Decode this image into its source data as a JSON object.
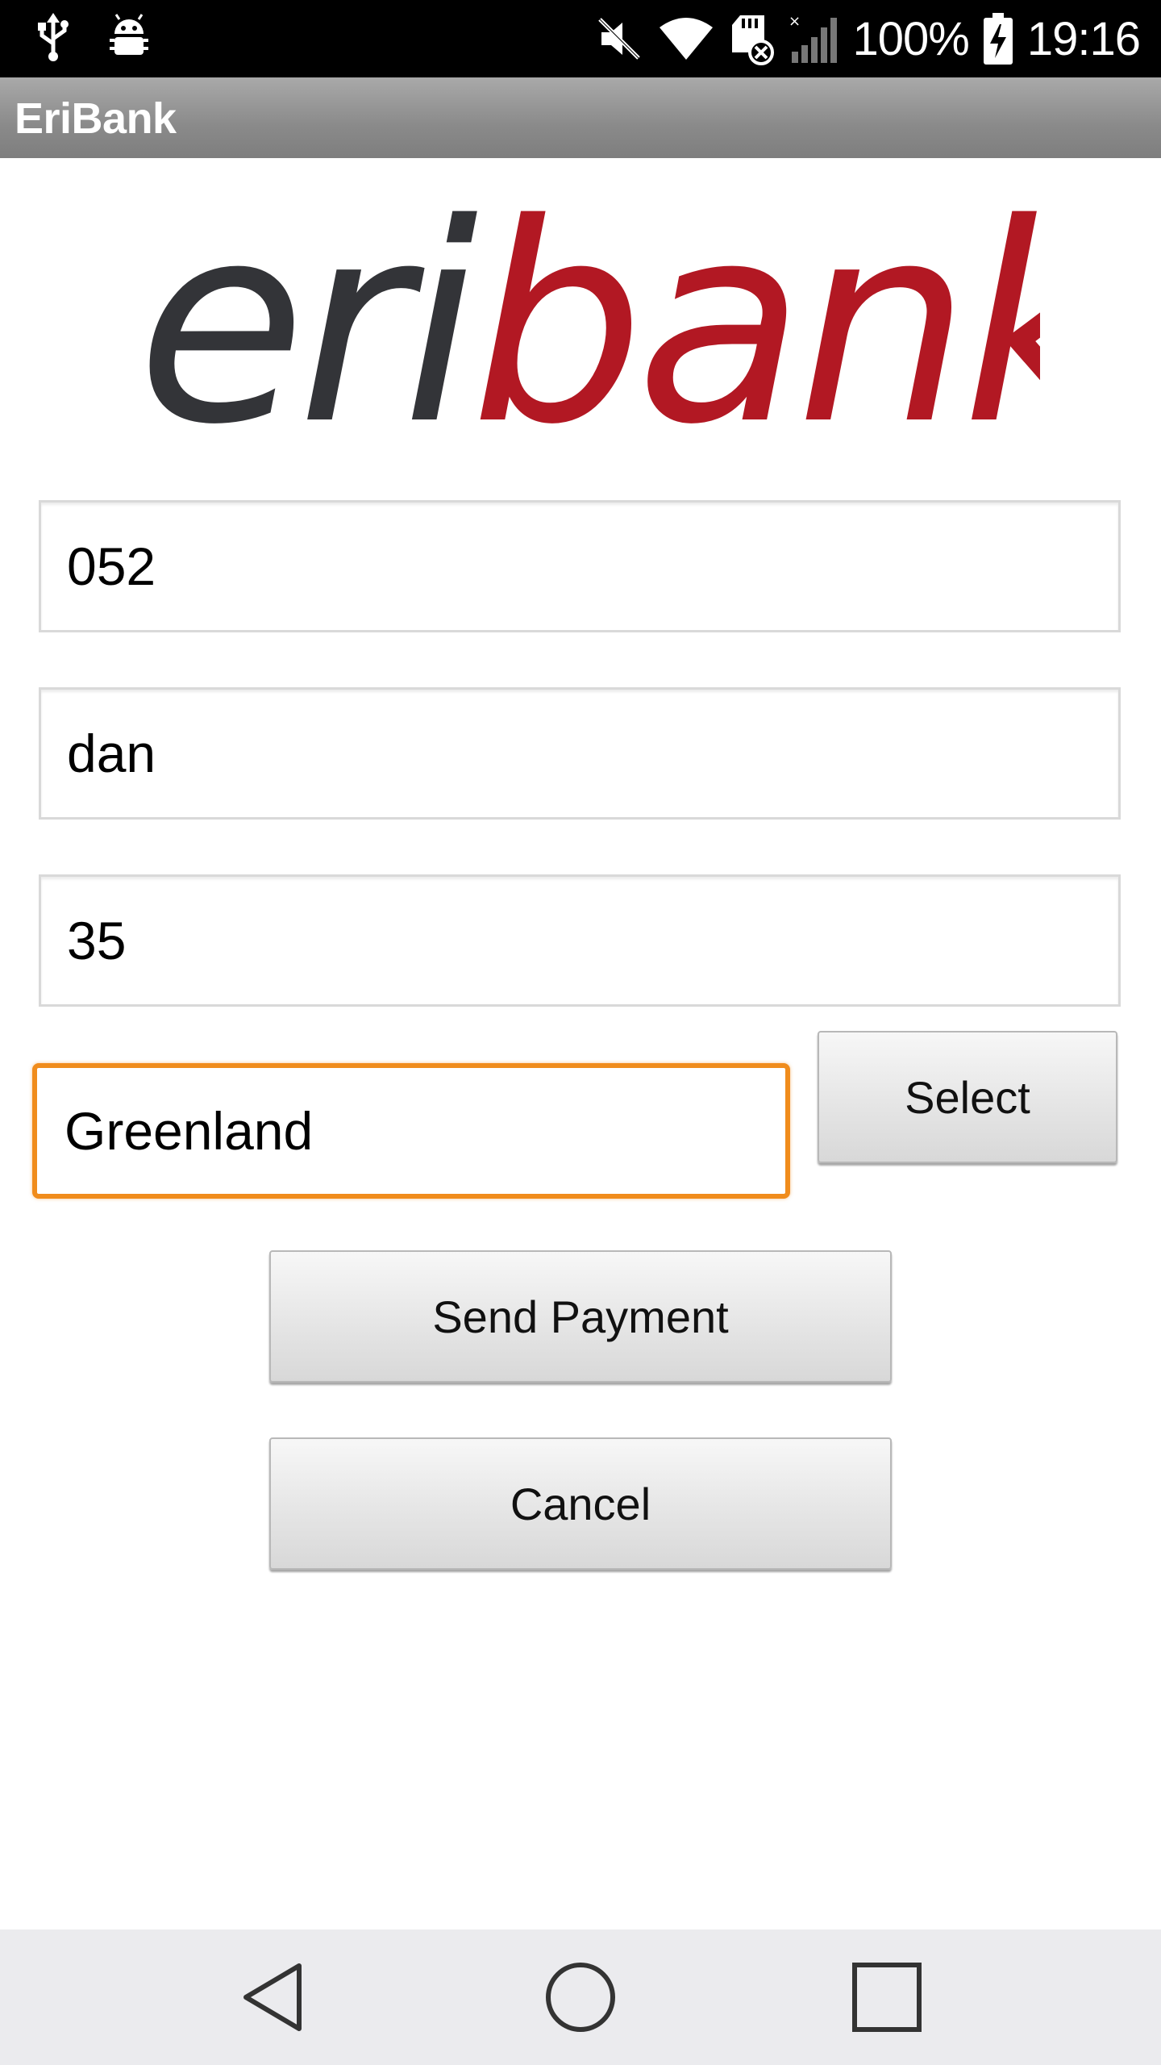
{
  "status_bar": {
    "battery_percent": "100%",
    "time": "19:16",
    "icons": [
      "usb-icon",
      "android-debug-icon",
      "mute-icon",
      "wifi-icon",
      "sd-card-icon",
      "signal-icon",
      "battery-charging-icon"
    ]
  },
  "action_bar": {
    "title": "EriBank"
  },
  "logo": {
    "part1": "eri",
    "part2": "bank",
    "colors": {
      "eri": "#333438",
      "bank": "#b21823"
    }
  },
  "form": {
    "phone": {
      "value": "052"
    },
    "name": {
      "value": "dan"
    },
    "amount": {
      "value": "35"
    },
    "country": {
      "value": "Greenland",
      "focused": true
    },
    "select_label": "Select",
    "send_label": "Send Payment",
    "cancel_label": "Cancel"
  },
  "nav_bar": {
    "buttons": [
      "back-icon",
      "home-icon",
      "recents-icon"
    ]
  },
  "colors": {
    "focus": "#f08c1c",
    "status_bar": "#000000",
    "action_bar": "#8a8a8a",
    "nav_bar": "#ebebee"
  }
}
